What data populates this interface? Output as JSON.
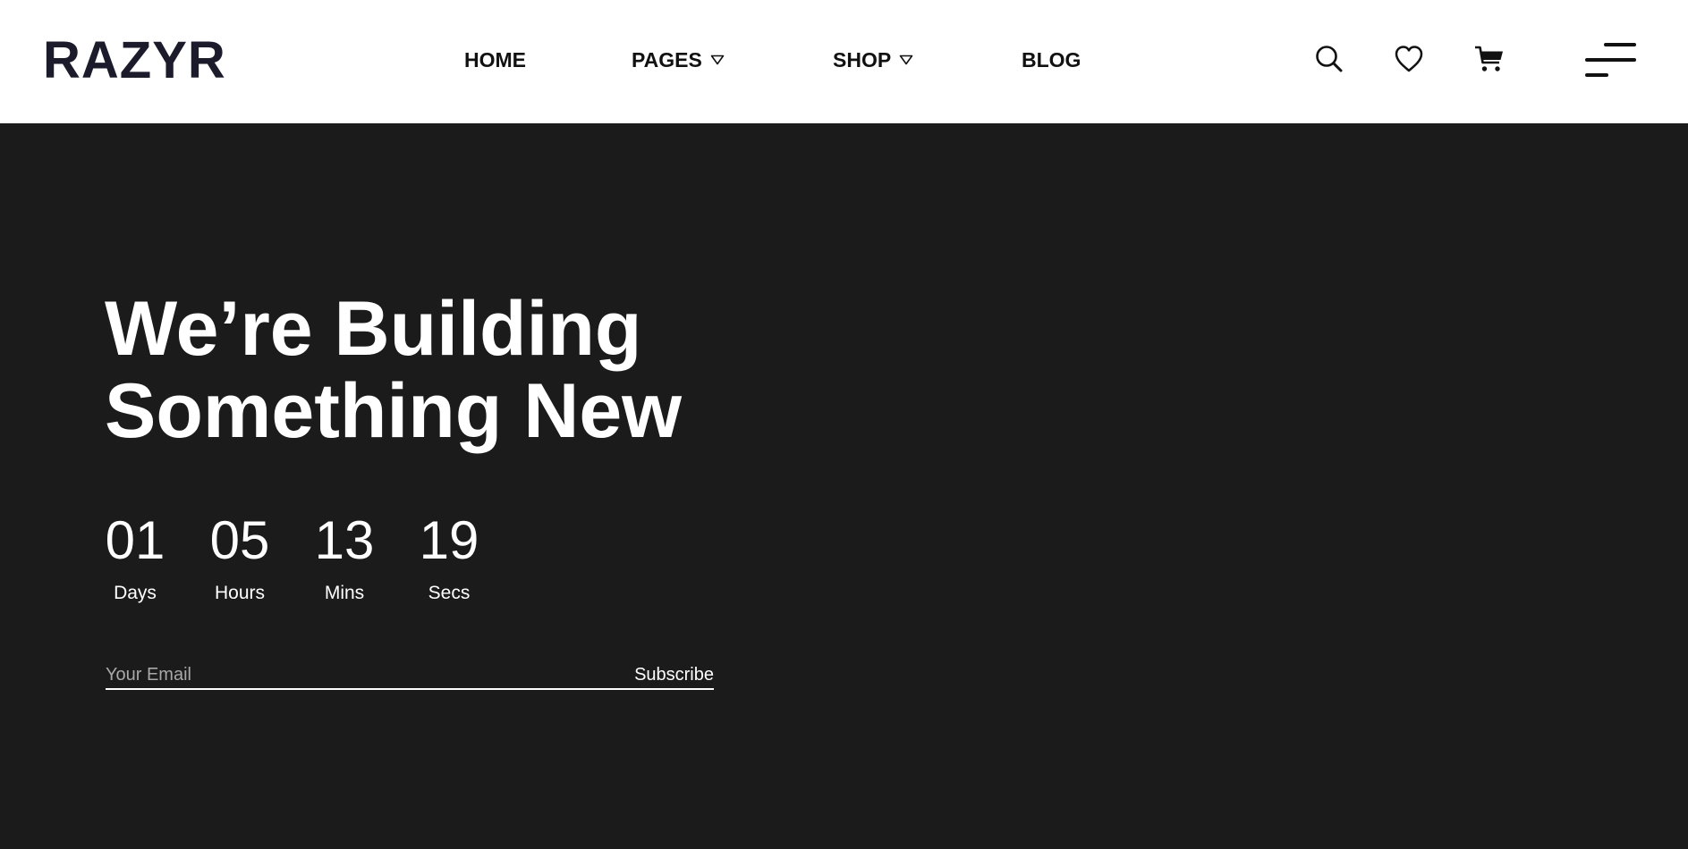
{
  "header": {
    "logo": "RAZYR",
    "nav": [
      {
        "label": "HOME",
        "has_dropdown": false
      },
      {
        "label": "PAGES",
        "has_dropdown": true
      },
      {
        "label": "SHOP",
        "has_dropdown": true
      },
      {
        "label": "BLOG",
        "has_dropdown": false
      }
    ],
    "icons": [
      "search-icon",
      "heart-icon",
      "cart-icon",
      "menu-icon"
    ]
  },
  "hero": {
    "headline_line1": "We’re Building",
    "headline_line2": "Something New",
    "countdown": [
      {
        "value": "01",
        "label": "Days"
      },
      {
        "value": "05",
        "label": "Hours"
      },
      {
        "value": "13",
        "label": "Mins"
      },
      {
        "value": "19",
        "label": "Secs"
      }
    ],
    "subscribe": {
      "placeholder": "Your Email",
      "value": "",
      "button_label": "Subscribe"
    }
  },
  "colors": {
    "header_bg": "#ffffff",
    "hero_bg": "#1b1b1b",
    "logo": "#1c1b2b",
    "text_on_dark": "#ffffff"
  }
}
